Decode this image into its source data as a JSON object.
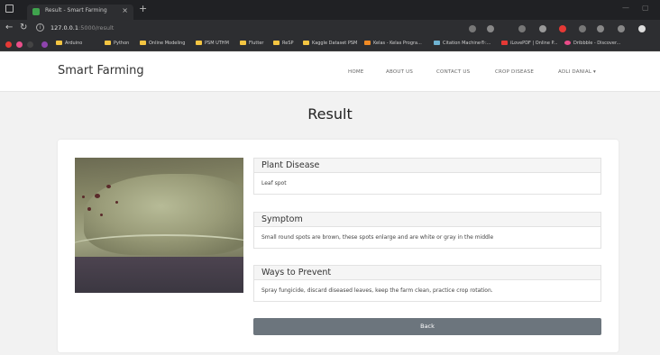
{
  "browser": {
    "tab_title": "Result - Smart Farming",
    "new_tab": "+",
    "tab_close": "×",
    "url_host": "127.0.0.1",
    "url_path": ":5000/result",
    "bookmarks": [
      "Arduino",
      "Python",
      "Online Modeling",
      "PSM UTHM",
      "Flutter",
      "ReSP",
      "Kaggle Dataset PSM",
      "Kelas - Kelas Progra...",
      "Citation Machine®:...",
      "iLovePDF | Online P...",
      "Dribbble - Discover..."
    ]
  },
  "navbar": {
    "brand": "Smart Farming",
    "links": [
      "HOME",
      "ABOUT US",
      "CONTACT US",
      "CROP DISEASE",
      "ADLI DANIAL ▾"
    ]
  },
  "page": {
    "title": "Result",
    "sections": [
      {
        "heading": "Plant Disease",
        "body": "Leaf spot"
      },
      {
        "heading": "Symptom",
        "body": "Small round spots are brown, these spots enlarge and are white or gray in the middle"
      },
      {
        "heading": "Ways to Prevent",
        "body": "Spray fungicide, discard diseased leaves, keep the farm clean, practice crop rotation."
      }
    ],
    "back_label": "Back"
  }
}
